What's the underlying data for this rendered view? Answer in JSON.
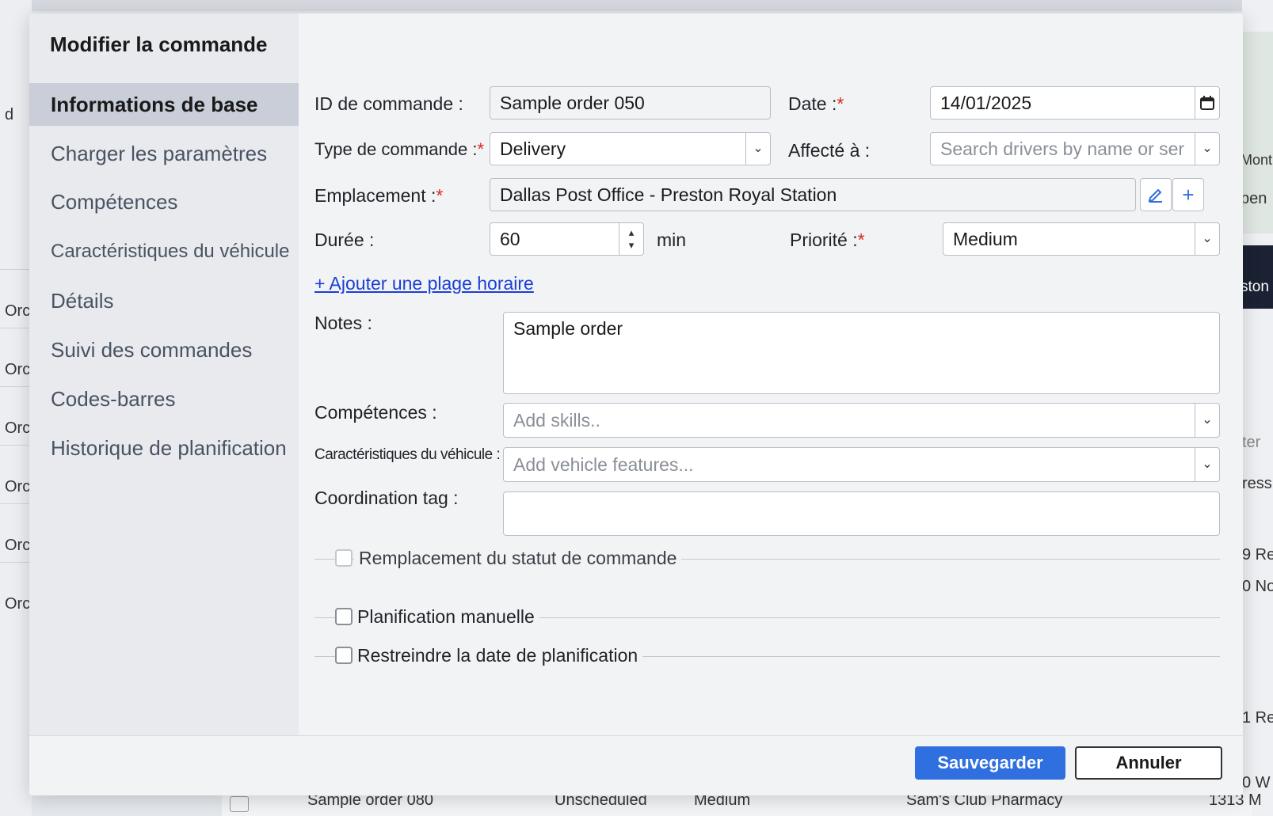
{
  "background": {
    "left_fragments": [
      "d",
      "Orc",
      "Orc",
      "Orc",
      "Orc",
      "Orc",
      "Orc"
    ],
    "right_fragments": [
      "Mont",
      "pen",
      "ston",
      "ter",
      "ress",
      "9 Re",
      "0 No",
      "1 Re",
      "0 W"
    ],
    "bottom_row": {
      "name": "Sample order 080",
      "status": "Unscheduled",
      "priority": "Medium",
      "location": "Sam's Club Pharmacy",
      "address": "1313 M"
    }
  },
  "dialog": {
    "title": "Modifier la commande",
    "nav": [
      {
        "label": "Informations de base",
        "active": true
      },
      {
        "label": "Charger les paramètres",
        "active": false
      },
      {
        "label": "Compétences",
        "active": false
      },
      {
        "label": "Caractéristiques du véhicule",
        "active": false
      },
      {
        "label": "Détails",
        "active": false
      },
      {
        "label": "Suivi des commandes",
        "active": false
      },
      {
        "label": "Codes-barres",
        "active": false
      },
      {
        "label": "Historique de planification",
        "active": false
      }
    ],
    "form": {
      "order_id_label": "ID de commande :",
      "order_id_value": "Sample order 050",
      "date_label": "Date :",
      "date_value": "14/01/2025",
      "order_type_label": "Type de commande :",
      "order_type_value": "Delivery",
      "assigned_label": "Affecté à :",
      "assigned_placeholder": "Search drivers by name or ser",
      "location_label": "Emplacement :",
      "location_value": "Dallas Post Office - Preston Royal Station",
      "duration_label": "Durée :",
      "duration_value": "60",
      "duration_unit": "min",
      "priority_label": "Priorité :",
      "priority_value": "Medium",
      "add_time_window": "+ Ajouter une plage horaire",
      "notes_label": "Notes :",
      "notes_value": "Sample order",
      "skills_label": "Compétences :",
      "skills_placeholder": "Add skills..",
      "vehicle_features_label": "Caractéristiques du véhicule :",
      "vehicle_features_placeholder": "Add vehicle features...",
      "coordination_label": "Coordination tag :",
      "coordination_value": "",
      "required_mark": "*",
      "status_override_label": "Remplacement du statut de commande",
      "manual_planning_label": "Planification manuelle",
      "restrict_date_label": "Restreindre la date de planification"
    },
    "save_label": "Sauvegarder",
    "cancel_label": "Annuler"
  },
  "icons": {
    "calendar": "calendar-icon",
    "chevron": "chevron-down-icon",
    "edit": "pencil-icon",
    "add": "plus-icon"
  },
  "colors": {
    "accent": "#2f6fdf",
    "required": "#d9281c",
    "link": "#1b3fd6"
  }
}
